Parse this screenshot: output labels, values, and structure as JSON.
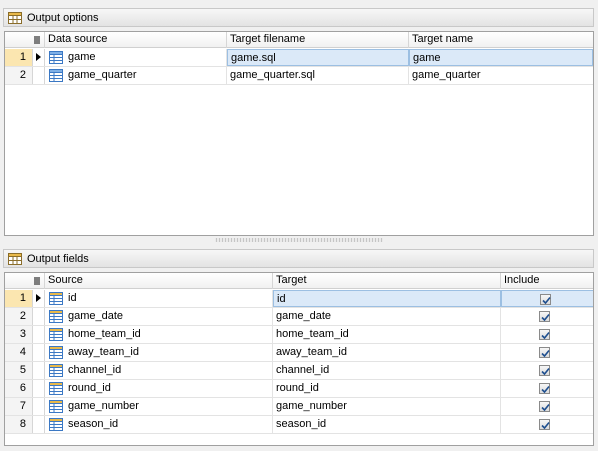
{
  "output_options": {
    "title": "Output options",
    "headers": [
      "Data source",
      "Target filename",
      "Target name"
    ],
    "rows": [
      {
        "num": "1",
        "source": "game",
        "filename": "game.sql",
        "name": "game"
      },
      {
        "num": "2",
        "source": "game_quarter",
        "filename": "game_quarter.sql",
        "name": "game_quarter"
      }
    ]
  },
  "output_fields": {
    "title": "Output fields",
    "headers": [
      "Source",
      "Target",
      "Include"
    ],
    "rows": [
      {
        "num": "1",
        "source": "id",
        "target": "id",
        "include": true
      },
      {
        "num": "2",
        "source": "game_date",
        "target": "game_date",
        "include": true
      },
      {
        "num": "3",
        "source": "home_team_id",
        "target": "home_team_id",
        "include": true
      },
      {
        "num": "4",
        "source": "away_team_id",
        "target": "away_team_id",
        "include": true
      },
      {
        "num": "5",
        "source": "channel_id",
        "target": "channel_id",
        "include": true
      },
      {
        "num": "6",
        "source": "round_id",
        "target": "round_id",
        "include": true
      },
      {
        "num": "7",
        "source": "game_number",
        "target": "game_number",
        "include": true
      },
      {
        "num": "8",
        "source": "season_id",
        "target": "season_id",
        "include": true
      }
    ]
  },
  "icons": {
    "panel": "table-grid-icon",
    "row": "table-icon",
    "checkbox": "checkmark-icon"
  },
  "colors": {
    "selection": "#dbe9f8",
    "current_row": "#fbe6b0",
    "icon_blue": "#3b78c4"
  }
}
